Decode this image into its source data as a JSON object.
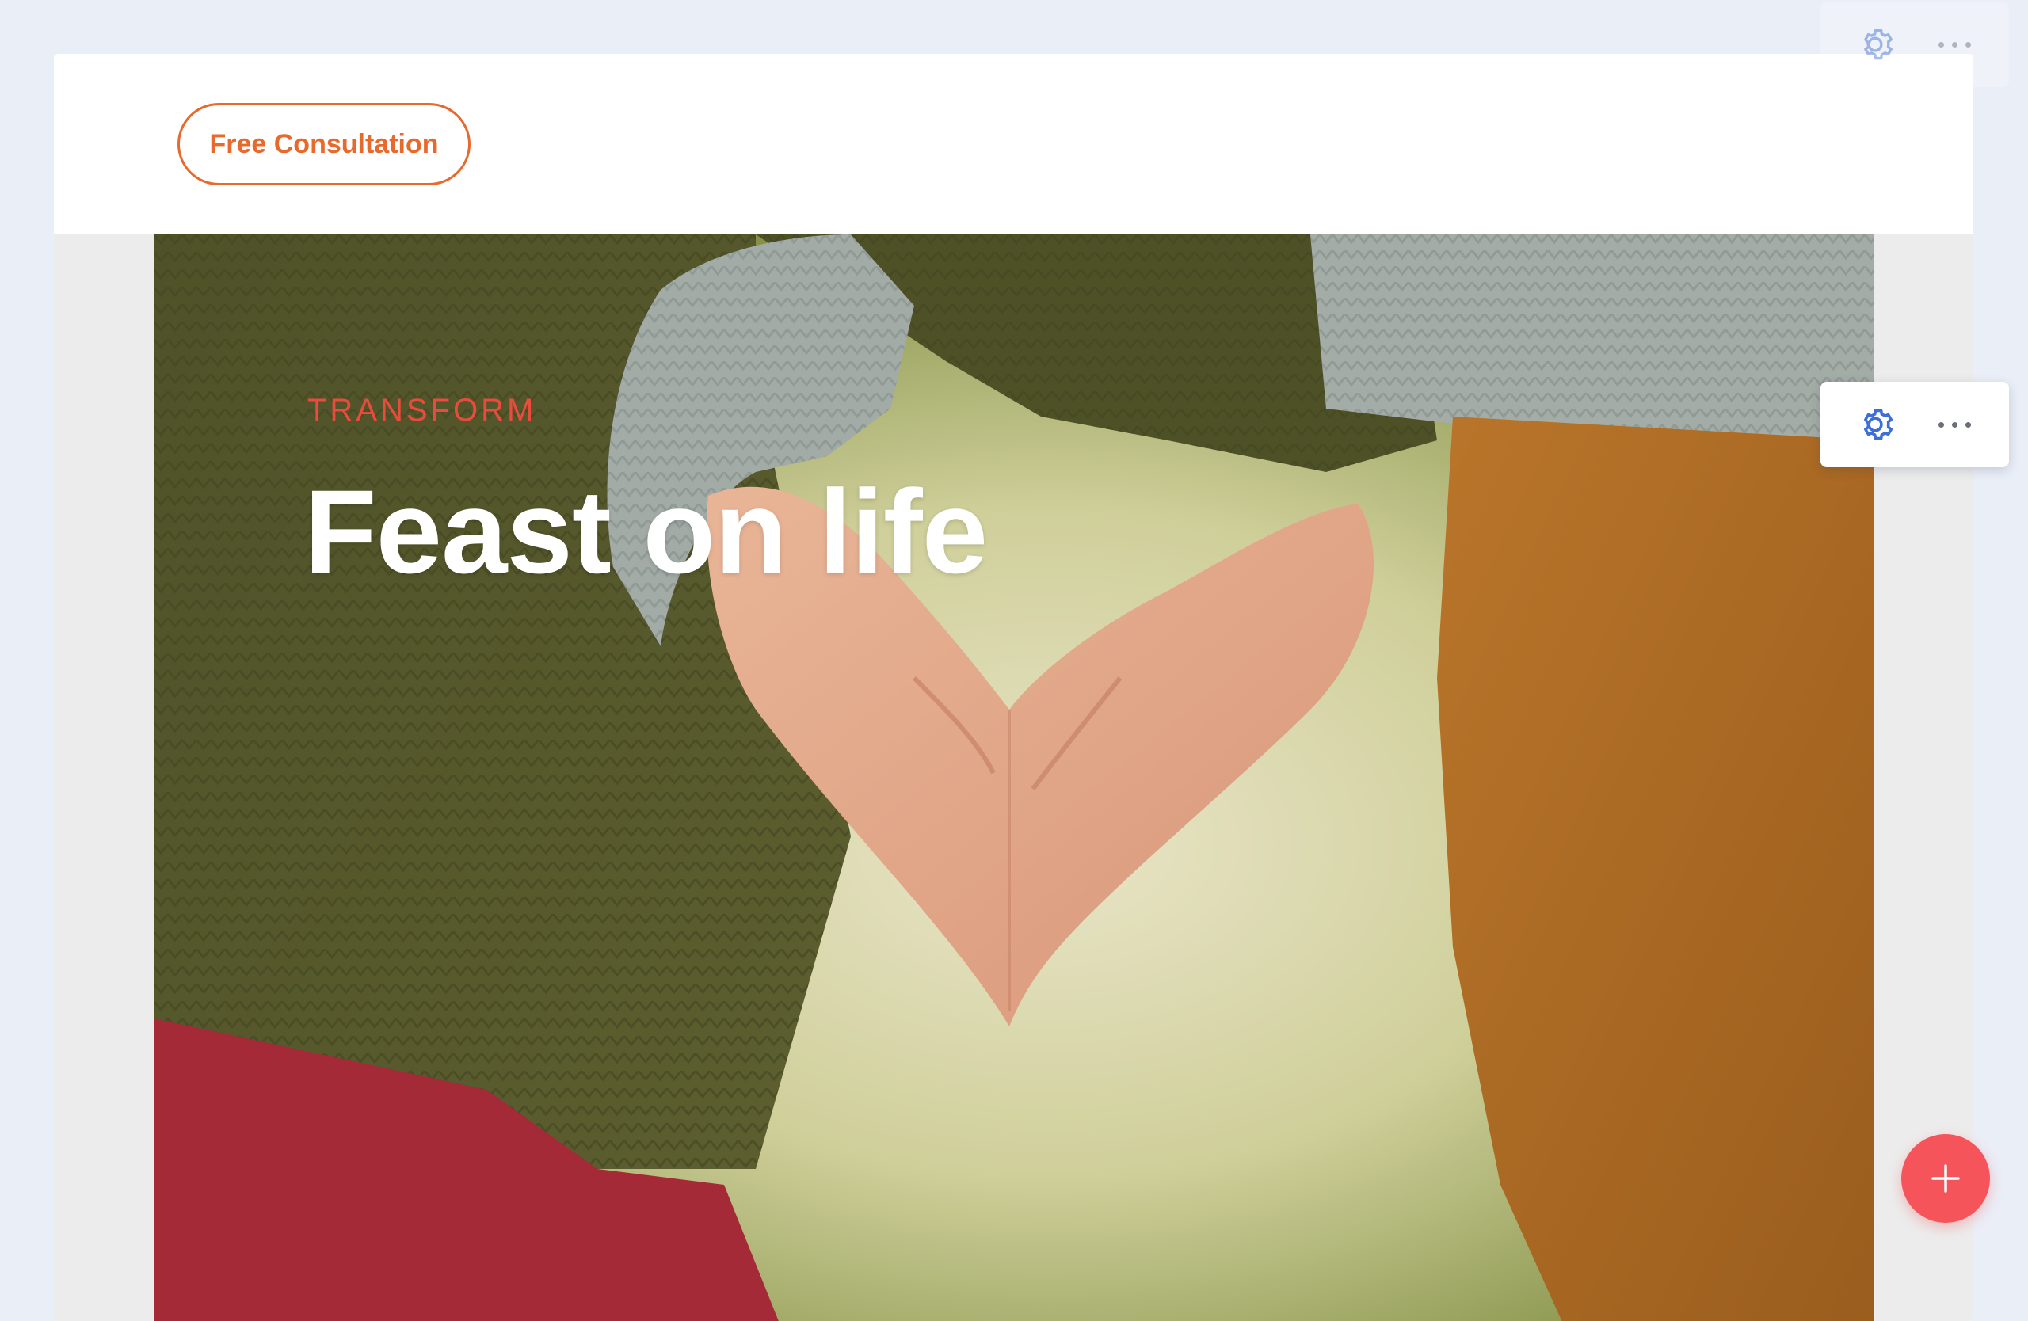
{
  "header": {
    "cta_label": "Free Consultation"
  },
  "hero": {
    "eyebrow": "TRANSFORM",
    "title": "Feast on life",
    "image_icon": "heart-hands-photo"
  },
  "toolbars": [
    {
      "settings_icon": "gear-icon",
      "more_icon": "more-dots-icon"
    },
    {
      "settings_icon": "gear-icon",
      "more_icon": "more-dots-icon"
    }
  ],
  "fab": {
    "icon": "plus-icon"
  },
  "colors": {
    "accent": "#e8692c",
    "eyebrow": "#e94b3c",
    "fab": "#f5555a",
    "gear": "#3d6fd6",
    "background": "#eaeef7"
  }
}
